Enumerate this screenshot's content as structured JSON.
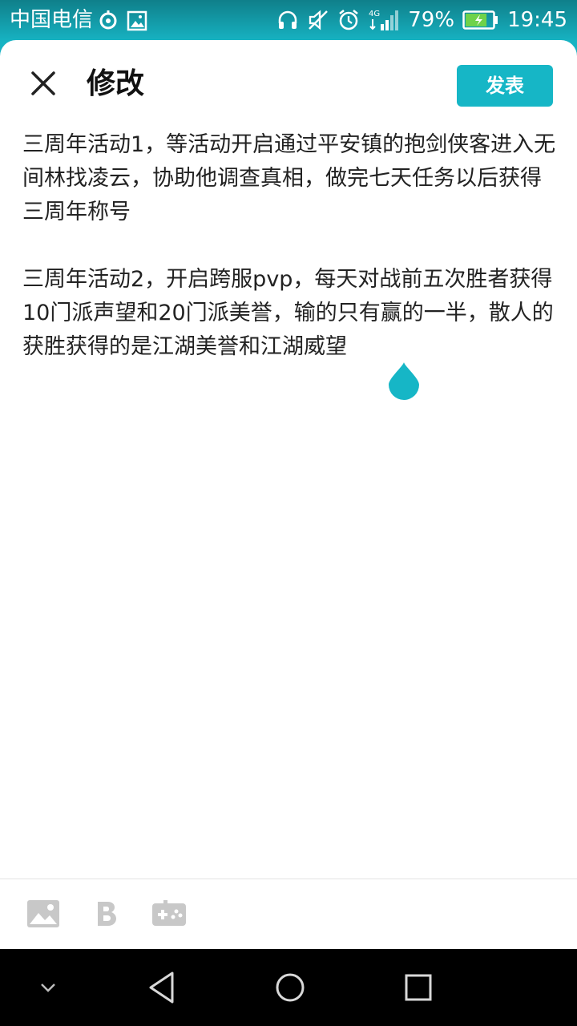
{
  "status_bar": {
    "carrier": "中国电信",
    "network": "4G",
    "battery": "79%",
    "time": "19:45",
    "battery_level": 0.79
  },
  "header": {
    "title": "修改",
    "publish_label": "发表"
  },
  "editor": {
    "paragraphs": [
      "三周年活动1，等活动开启通过平安镇的抱剑侠客进入无间林找凌云，协助他调查真相，做完七天任务以后获得三周年称号",
      "三周年活动2，开启跨服pvp，每天对战前五次胜者获得10门派声望和20门派美誉，输的只有赢的一半，散人的获胜获得的是江湖美誉和江湖威望"
    ]
  },
  "colors": {
    "accent": "#16b6c6",
    "text": "#222222",
    "icon_gray": "#c8c8c8"
  },
  "toolbar": {
    "icons": [
      "image-icon",
      "bold-icon",
      "gamepad-icon"
    ]
  },
  "navbar": {
    "icons": [
      "chevron-down-icon",
      "back-icon",
      "home-icon",
      "recents-icon"
    ]
  }
}
